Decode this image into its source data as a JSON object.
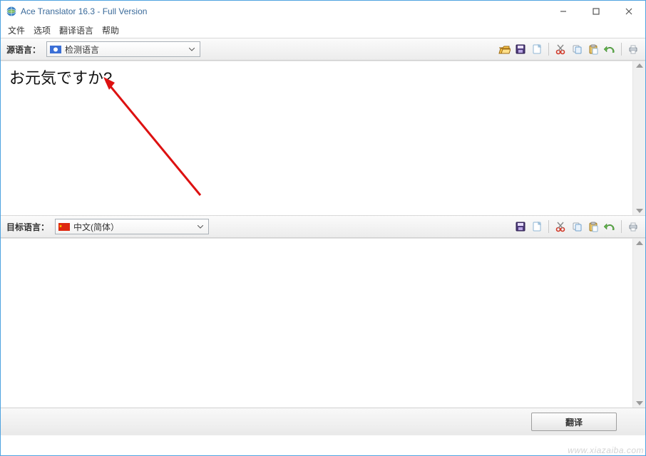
{
  "window": {
    "title": "Ace Translator 16.3 - Full Version"
  },
  "menu": {
    "file": "文件",
    "options": "选项",
    "trans_lang": "翻译语言",
    "help": "帮助"
  },
  "source": {
    "label": "源语言：",
    "selected": "检测语言",
    "text": "お元気ですか?",
    "icons": [
      "open-folder",
      "save",
      "new-doc",
      "cut",
      "copy",
      "paste",
      "undo",
      "print"
    ]
  },
  "target": {
    "label": "目标语言：",
    "selected": "中文(简体）",
    "text": "",
    "icons": [
      "save",
      "new-doc",
      "cut",
      "copy",
      "paste",
      "undo",
      "print"
    ]
  },
  "translate_button": "翻译",
  "watermark": "www.xiazaiba.com"
}
